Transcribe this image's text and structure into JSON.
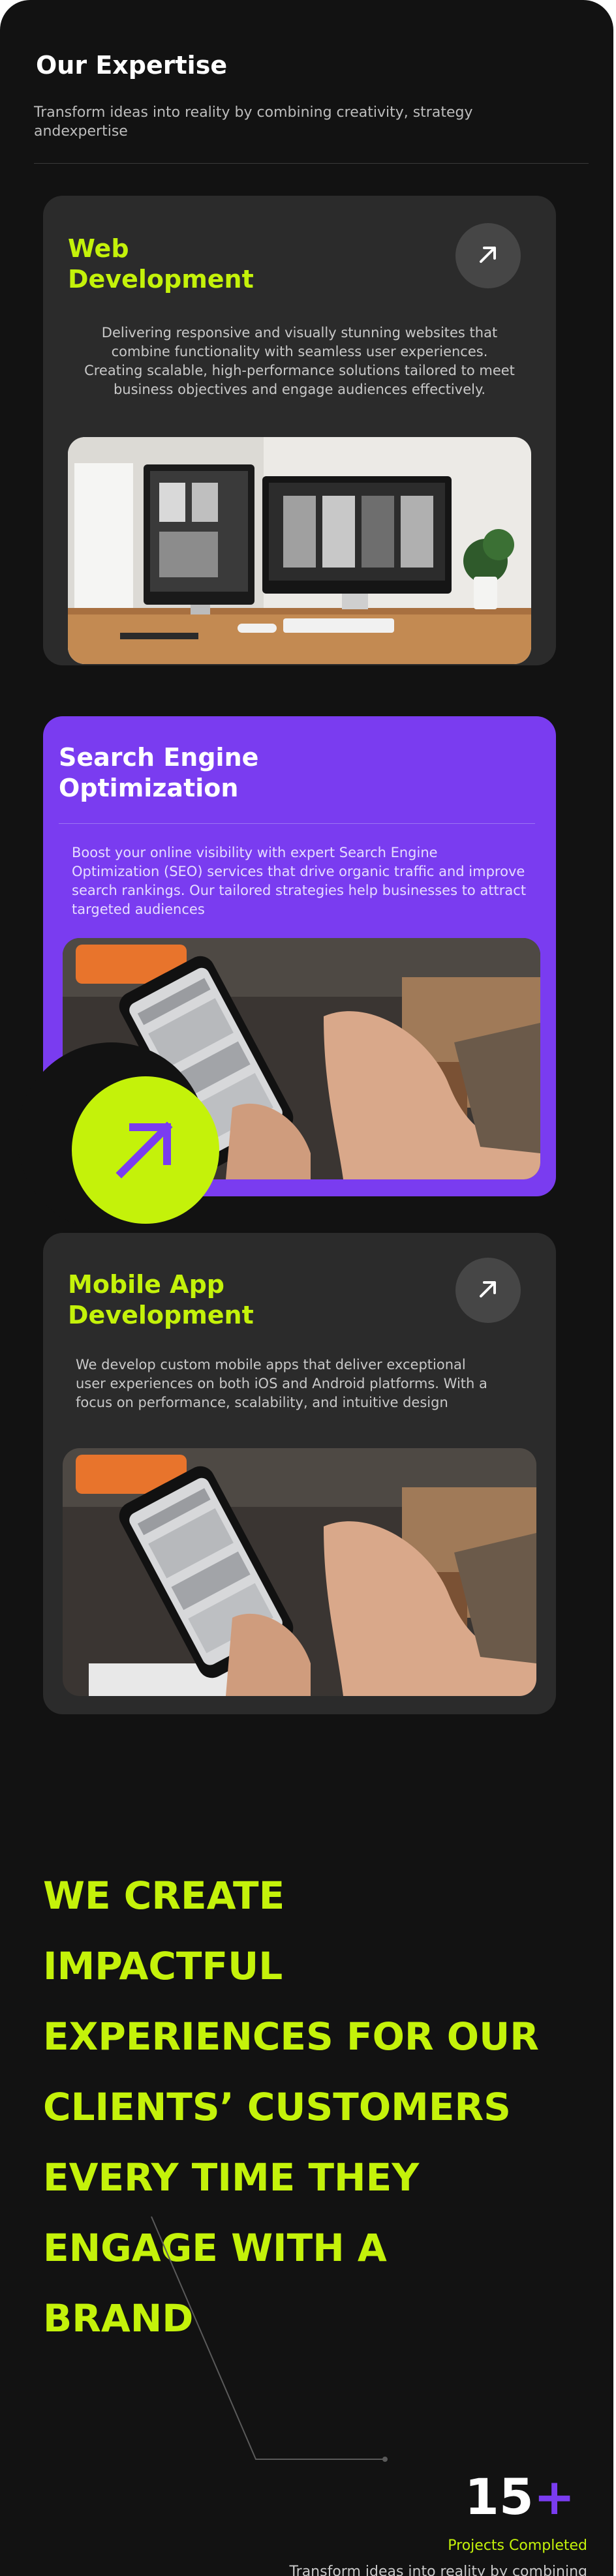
{
  "header": {
    "title": "Our Expertise",
    "subtitle": "Transform ideas into reality by combining creativity, strategy andexpertise"
  },
  "services": [
    {
      "title": "Web Development",
      "description": "Delivering responsive and visually stunning websites that combine functionality with seamless user experiences. Creating scalable, high-performance solutions tailored to meet business objectives and engage audiences effectively.",
      "icon": "arrow-up-right-icon"
    },
    {
      "title": "Search Engine Optimization",
      "description": "Boost your online visibility with expert Search Engine Optimization (SEO) services that drive organic traffic and improve search rankings. Our tailored strategies help businesses to attract targeted audiences",
      "icon": "arrow-up-right-icon"
    },
    {
      "title": "Mobile App Development",
      "description": "We develop custom mobile apps that deliver exceptional user experiences on both iOS and Android platforms. With a focus on performance, scalability, and intuitive design",
      "icon": "arrow-up-right-icon"
    }
  ],
  "statement": {
    "lines": [
      "WE CREATE",
      "IMPACTFUL",
      "EXPERIENCES FOR OUR",
      "CLIENTS’ CUSTOMERS",
      "EVERY TIME THEY",
      "ENGAGE WITH A",
      "BRAND"
    ]
  },
  "stats": {
    "number": "15",
    "suffix": "+",
    "label": "Projects Completed",
    "description": "Transform ideas into reality by combining creativity, strategy andexpertise"
  },
  "colors": {
    "accent": "#c4f20a",
    "purple": "#7a3cf0",
    "background": "#121212",
    "card": "#2b2b2b"
  }
}
